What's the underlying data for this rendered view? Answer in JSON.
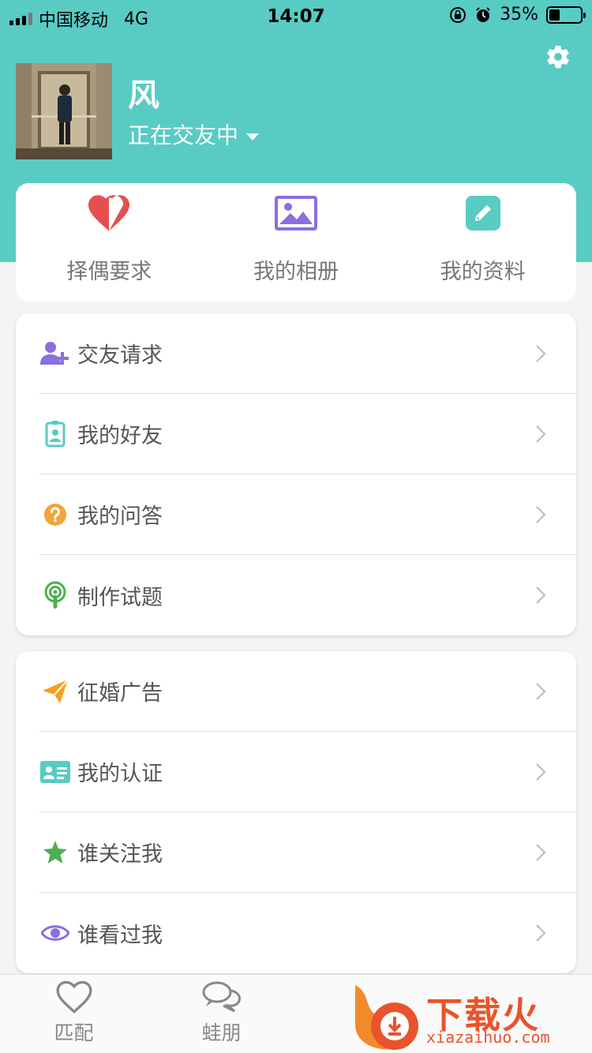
{
  "status_bar": {
    "carrier": "中国移动",
    "network": "4G",
    "time": "14:07",
    "battery_percent": "35%",
    "battery_level": 0.35
  },
  "profile": {
    "name": "风",
    "status": "正在交友中"
  },
  "quick_actions": [
    {
      "label": "择偶要求",
      "icon": "heart-icon",
      "color": "#e5504f"
    },
    {
      "label": "我的相册",
      "icon": "image-icon",
      "color": "#8b6ee0"
    },
    {
      "label": "我的资料",
      "icon": "edit-icon",
      "color": "#58cbc3"
    }
  ],
  "menu_group_1": [
    {
      "label": "交友请求",
      "icon": "add-user-icon",
      "color": "#8b6ee0"
    },
    {
      "label": "我的好友",
      "icon": "contact-badge-icon",
      "color": "#58cbc3"
    },
    {
      "label": "我的问答",
      "icon": "question-icon",
      "color": "#f0a63a"
    },
    {
      "label": "制作试题",
      "icon": "podcast-icon",
      "color": "#4caf50"
    }
  ],
  "menu_group_2": [
    {
      "label": "征婚广告",
      "icon": "paper-plane-icon",
      "color": "#f7a21b"
    },
    {
      "label": "我的认证",
      "icon": "id-card-icon",
      "color": "#58cbc3"
    },
    {
      "label": "谁关注我",
      "icon": "star-icon",
      "color": "#4caf50"
    },
    {
      "label": "谁看过我",
      "icon": "eye-icon",
      "color": "#8b6ee0"
    }
  ],
  "tabs": [
    {
      "label": "匹配",
      "icon": "heart-outline-icon"
    },
    {
      "label": "蛙朋",
      "icon": "chat-bubbles-icon"
    }
  ],
  "watermark": {
    "text": "下载火",
    "url": "xiazaihuo.com"
  }
}
